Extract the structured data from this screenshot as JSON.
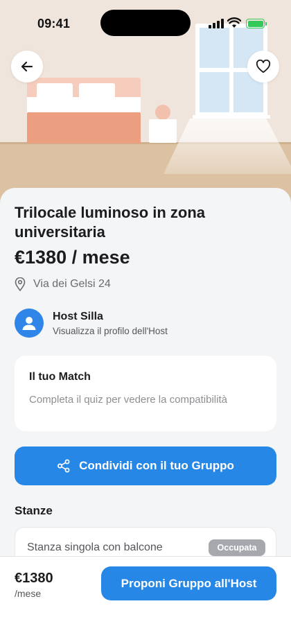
{
  "status_bar": {
    "time": "09:41"
  },
  "listing": {
    "title": "Trilocale luminoso in zona universitaria",
    "price": "€1380 / mese",
    "address": "Via dei Gelsi 24"
  },
  "host": {
    "name": "Host Silla",
    "link_label": "Visualizza il profilo dell'Host"
  },
  "match": {
    "title": "Il tuo Match",
    "description": "Completa il quiz per vedere la compatibilità"
  },
  "share_button": {
    "label": "Condividi con il tuo Gruppo"
  },
  "rooms": {
    "title": "Stanze",
    "items": [
      {
        "name": "Stanza singola con balcone",
        "status": "Occupata"
      }
    ]
  },
  "bottom_bar": {
    "price": "€1380",
    "period": "/mese",
    "cta_label": "Proponi Gruppo all'Host"
  },
  "colors": {
    "primary": "#2787e6",
    "battery": "#34c759",
    "badge": "#a6a8ad"
  },
  "icons": [
    "back-arrow-icon",
    "heart-icon",
    "location-pin-icon",
    "user-icon",
    "share-icon"
  ]
}
